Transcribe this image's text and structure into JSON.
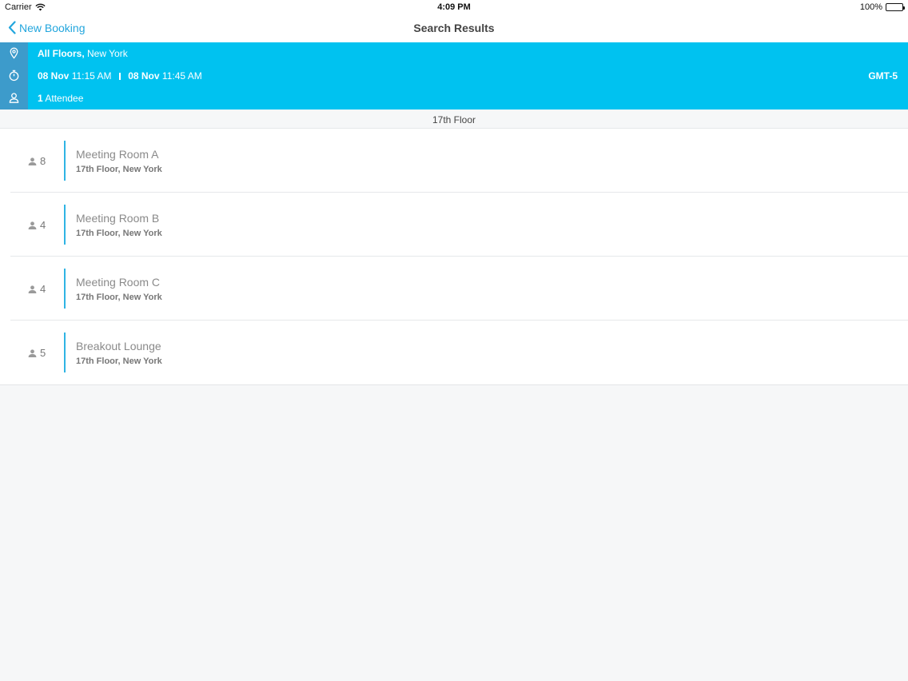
{
  "status_bar": {
    "carrier": "Carrier",
    "time": "4:09 PM",
    "battery": "100%"
  },
  "nav": {
    "back_label": "New Booking",
    "title": "Search Results"
  },
  "summary": {
    "location_bold": "All Floors,",
    "location_rest": "New York",
    "start_date": "08 Nov",
    "start_time": "11:15 AM",
    "end_date": "08 Nov",
    "end_time": "11:45 AM",
    "timezone": "GMT-5",
    "attendee_count": "1",
    "attendee_label": "Attendee"
  },
  "section": {
    "header": "17th Floor"
  },
  "rooms": [
    {
      "capacity": "8",
      "name": "Meeting Room A",
      "location": "17th Floor, New York"
    },
    {
      "capacity": "4",
      "name": "Meeting Room B",
      "location": "17th Floor, New York"
    },
    {
      "capacity": "4",
      "name": "Meeting Room C",
      "location": "17th Floor, New York"
    },
    {
      "capacity": "5",
      "name": "Breakout Lounge",
      "location": "17th Floor, New York"
    }
  ],
  "icons": {
    "wifi": "wifi-icon",
    "back": "chevron-left-icon",
    "location": "map-pin-icon",
    "time": "stopwatch-icon",
    "attendee": "person-icon",
    "capacity": "person-icon"
  },
  "colors": {
    "accent": "#23a6dd",
    "summary_bg": "#00c2f0",
    "summary_icon_col": "#3d9bcb"
  }
}
